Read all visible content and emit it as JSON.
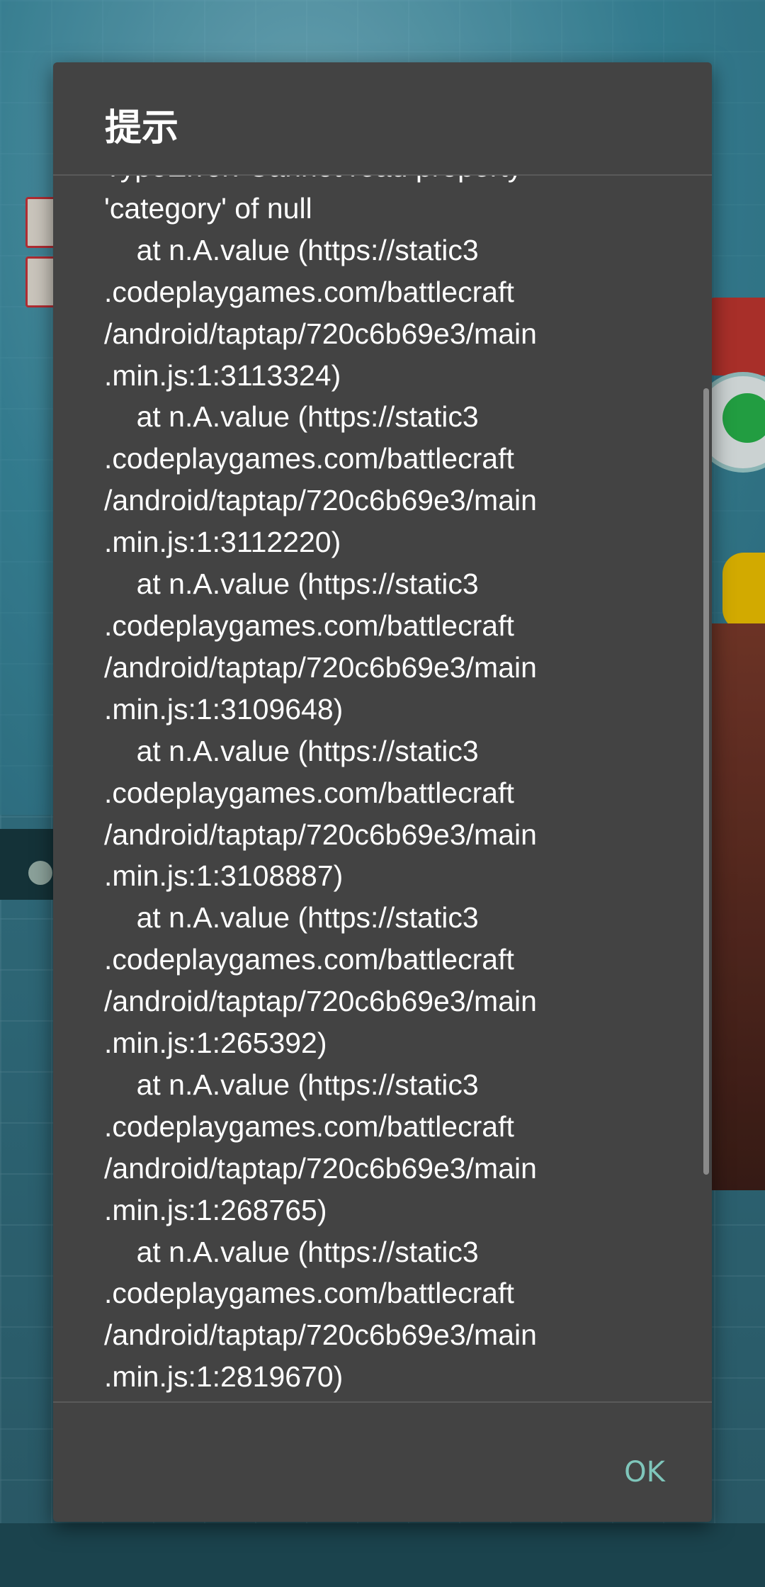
{
  "dialog": {
    "title": "提示",
    "message": "TypeError: Cannot read property\n'category' of null\n    at n.A.value (https://static3\n.codeplaygames.com/battlecraft\n/android/taptap/720c6b69e3/main\n.min.js:1:3113324)\n    at n.A.value (https://static3\n.codeplaygames.com/battlecraft\n/android/taptap/720c6b69e3/main\n.min.js:1:3112220)\n    at n.A.value (https://static3\n.codeplaygames.com/battlecraft\n/android/taptap/720c6b69e3/main\n.min.js:1:3109648)\n    at n.A.value (https://static3\n.codeplaygames.com/battlecraft\n/android/taptap/720c6b69e3/main\n.min.js:1:3108887)\n    at n.A.value (https://static3\n.codeplaygames.com/battlecraft\n/android/taptap/720c6b69e3/main\n.min.js:1:265392)\n    at n.A.value (https://static3\n.codeplaygames.com/battlecraft\n/android/taptap/720c6b69e3/main\n.min.js:1:268765)\n    at n.A.value (https://static3\n.codeplaygames.com/battlecraft\n/android/taptap/720c6b69e3/main\n.min.js:1:2819670)",
    "ok_label": "OK"
  },
  "colors": {
    "dialog_background": "#434343",
    "accent": "#7fc6bb",
    "text": "#ffffff"
  }
}
